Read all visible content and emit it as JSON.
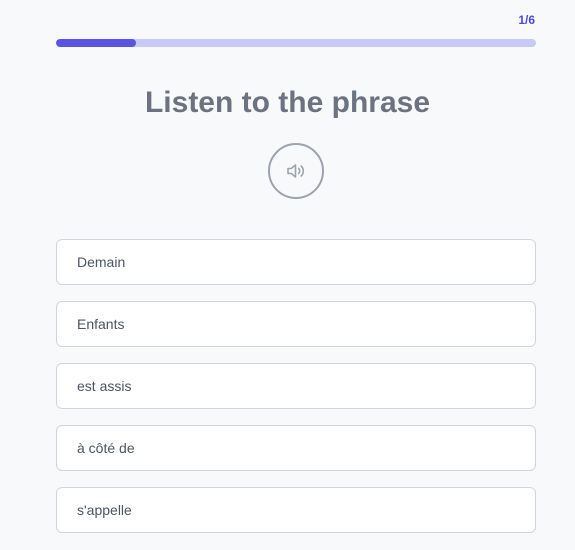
{
  "progress": {
    "counter": "1/6",
    "fraction": 0.1667
  },
  "title": "Listen to the phrase",
  "audio_button": {
    "icon": "speaker-icon"
  },
  "options": [
    "Demain",
    "Enfants",
    "est assis",
    "à côté de",
    "s'appelle"
  ],
  "colors": {
    "accent": "#5b54e0",
    "track": "#c7caf7",
    "title": "#6b7280"
  }
}
